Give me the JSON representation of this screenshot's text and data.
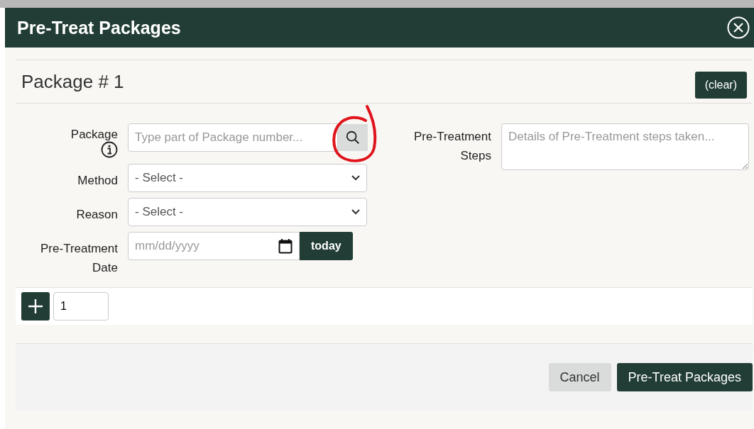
{
  "dialog": {
    "title": "Pre-Treat Packages"
  },
  "package": {
    "heading": "Package # 1",
    "clear_button": "(clear)"
  },
  "fields": [
    {
      "kind": "search",
      "label": "Package",
      "info": true,
      "placeholder": "Type part of Package number..."
    },
    {
      "kind": "select",
      "label": "Method",
      "value": "- Select -"
    },
    {
      "kind": "select",
      "label": "Reason",
      "value": "- Select -"
    },
    {
      "kind": "date",
      "label": "Pre-Treatment Date",
      "placeholder": "mm/dd/yyyy",
      "button": "today"
    }
  ],
  "steps": {
    "label": "Pre-Treatment Steps",
    "placeholder": "Details of Pre-Treatment steps taken..."
  },
  "add_row": {
    "count": "1"
  },
  "buttons": [
    {
      "kind": "secondary",
      "label": "Cancel"
    },
    {
      "kind": "primary",
      "label": "Pre-Treat Packages"
    }
  ]
}
